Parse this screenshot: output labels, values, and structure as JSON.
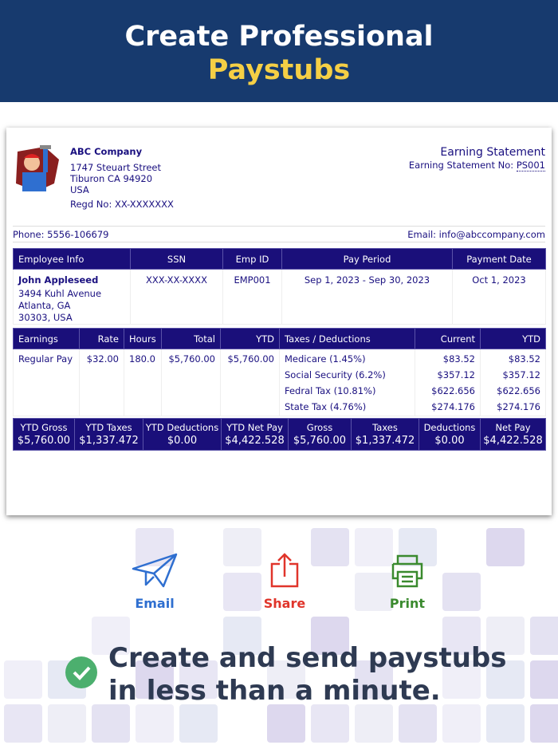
{
  "hero": {
    "line1": "Create Professional",
    "line2": "Paystubs"
  },
  "company": {
    "name": "ABC Company",
    "street": "1747 Steuart Street",
    "city": "Tiburon CA 94920",
    "country": "USA",
    "regd": "Regd No: XX-XXXXXXX",
    "phone": "Phone: 5556-106679",
    "email": "Email: info@abccompany.com"
  },
  "statement": {
    "title": "Earning Statement",
    "no_label": "Earning Statement No:",
    "no": "PS001"
  },
  "employee_table": {
    "headers": [
      "Employee Info",
      "SSN",
      "Emp ID",
      "Pay Period",
      "Payment Date"
    ],
    "name": "John Appleseed",
    "addr1": "3494 Kuhl Avenue",
    "addr2": "Atlanta, GA",
    "addr3": "30303, USA",
    "ssn": "XXX-XX-XXXX",
    "emp_id": "EMP001",
    "period": "Sep 1, 2023 - Sep 30, 2023",
    "pay_date": "Oct 1, 2023"
  },
  "earnings_table": {
    "headers": [
      "Earnings",
      "Rate",
      "Hours",
      "Total",
      "YTD",
      "Taxes / Deductions",
      "Current",
      "YTD"
    ],
    "earning": {
      "name": "Regular Pay",
      "rate": "$32.00",
      "hours": "180.0",
      "total": "$5,760.00",
      "ytd": "$5,760.00"
    },
    "taxes": [
      {
        "name": "Medicare (1.45%)",
        "current": "$83.52",
        "ytd": "$83.52"
      },
      {
        "name": "Social Security (6.2%)",
        "current": "$357.12",
        "ytd": "$357.12"
      },
      {
        "name": "Fedral Tax (10.81%)",
        "current": "$622.656",
        "ytd": "$622.656"
      },
      {
        "name": "State Tax (4.76%)",
        "current": "$274.176",
        "ytd": "$274.176"
      }
    ]
  },
  "summary": [
    {
      "label": "YTD Gross",
      "value": "$5,760.00"
    },
    {
      "label": "YTD Taxes",
      "value": "$1,337.472"
    },
    {
      "label": "YTD Deductions",
      "value": "$0.00"
    },
    {
      "label": "YTD Net Pay",
      "value": "$4,422.528"
    },
    {
      "label": "Gross",
      "value": "$5,760.00"
    },
    {
      "label": "Taxes",
      "value": "$1,337.472"
    },
    {
      "label": "Deductions",
      "value": "$0.00"
    },
    {
      "label": "Net Pay",
      "value": "$4,422.528"
    }
  ],
  "actions": {
    "email": "Email",
    "share": "Share",
    "print": "Print",
    "colors": {
      "email": "#2f6fd0",
      "share": "#e0352b",
      "print": "#3a8a2e"
    }
  },
  "tagline": "Create and send paystubs in less than a minute."
}
